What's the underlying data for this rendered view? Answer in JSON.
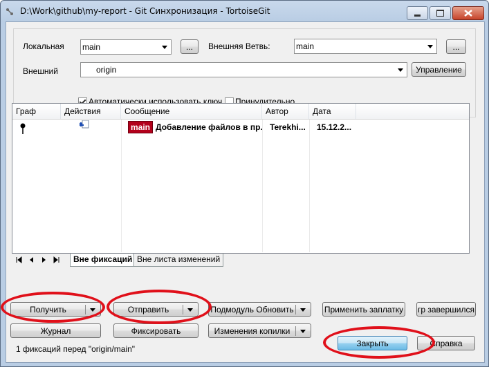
{
  "window": {
    "title": "D:\\Work\\github\\my-report - Git Синхронизация - TortoiseGit",
    "icons": [
      "app-icon",
      "minimize-icon",
      "maximize-icon",
      "close-icon"
    ]
  },
  "form": {
    "local_label": "Локальная",
    "local_value": "main",
    "browse_label": "...",
    "remote_branch_label": "Внешняя Ветвь:",
    "remote_branch_value": "main",
    "remote_label": "Внешний",
    "remote_value": "origin",
    "manage_label": "Управление",
    "autoload_key_label": "Автоматически использовать ключ",
    "autoload_key_checked": true,
    "force_label": "Принудительно",
    "force_checked": false
  },
  "log": {
    "columns": [
      "Граф",
      "Действия",
      "Сообщение",
      "Автор",
      "Дата"
    ],
    "rows": [
      {
        "branch_badge": "main",
        "message": "Добавление файлов в пр...",
        "author": "Terekhi...",
        "date": "15.12.2..."
      }
    ]
  },
  "tabs": [
    "Вне фиксаций",
    "Вне листа изменений"
  ],
  "buttons": {
    "pull": "Получить",
    "push": "Отправить",
    "submodule_update": "Подмодуль Обновить",
    "apply_patch": "Применить заплатку",
    "rebase_done": "гр завершился",
    "log": "Журнал",
    "commit": "Фиксировать",
    "stash": "Изменения копилки",
    "close": "Закрыть",
    "help": "Справка"
  },
  "status": "1 фиксаций перед \"origin/main\"",
  "colors": {
    "badge": "#b3001b",
    "highlight_ring": "#e0101a",
    "accent": "#3c7fb1"
  }
}
